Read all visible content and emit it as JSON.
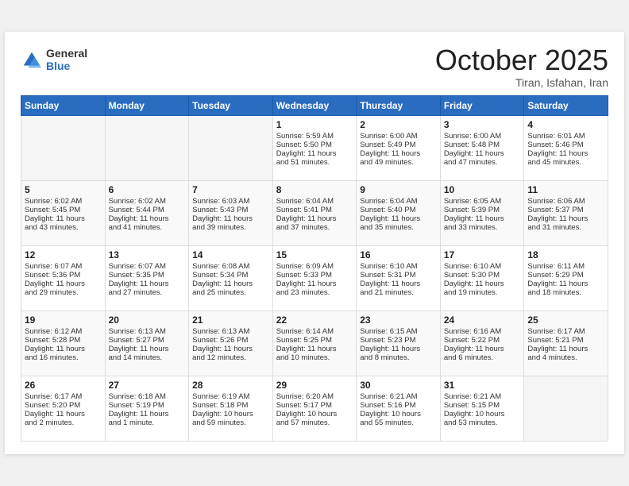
{
  "logo": {
    "general": "General",
    "blue": "Blue"
  },
  "header": {
    "month": "October 2025",
    "location": "Tiran, Isfahan, Iran"
  },
  "weekdays": [
    "Sunday",
    "Monday",
    "Tuesday",
    "Wednesday",
    "Thursday",
    "Friday",
    "Saturday"
  ],
  "weeks": [
    [
      {
        "day": "",
        "info": ""
      },
      {
        "day": "",
        "info": ""
      },
      {
        "day": "",
        "info": ""
      },
      {
        "day": "1",
        "info": "Sunrise: 5:59 AM\nSunset: 5:50 PM\nDaylight: 11 hours\nand 51 minutes."
      },
      {
        "day": "2",
        "info": "Sunrise: 6:00 AM\nSunset: 5:49 PM\nDaylight: 11 hours\nand 49 minutes."
      },
      {
        "day": "3",
        "info": "Sunrise: 6:00 AM\nSunset: 5:48 PM\nDaylight: 11 hours\nand 47 minutes."
      },
      {
        "day": "4",
        "info": "Sunrise: 6:01 AM\nSunset: 5:46 PM\nDaylight: 11 hours\nand 45 minutes."
      }
    ],
    [
      {
        "day": "5",
        "info": "Sunrise: 6:02 AM\nSunset: 5:45 PM\nDaylight: 11 hours\nand 43 minutes."
      },
      {
        "day": "6",
        "info": "Sunrise: 6:02 AM\nSunset: 5:44 PM\nDaylight: 11 hours\nand 41 minutes."
      },
      {
        "day": "7",
        "info": "Sunrise: 6:03 AM\nSunset: 5:43 PM\nDaylight: 11 hours\nand 39 minutes."
      },
      {
        "day": "8",
        "info": "Sunrise: 6:04 AM\nSunset: 5:41 PM\nDaylight: 11 hours\nand 37 minutes."
      },
      {
        "day": "9",
        "info": "Sunrise: 6:04 AM\nSunset: 5:40 PM\nDaylight: 11 hours\nand 35 minutes."
      },
      {
        "day": "10",
        "info": "Sunrise: 6:05 AM\nSunset: 5:39 PM\nDaylight: 11 hours\nand 33 minutes."
      },
      {
        "day": "11",
        "info": "Sunrise: 6:06 AM\nSunset: 5:37 PM\nDaylight: 11 hours\nand 31 minutes."
      }
    ],
    [
      {
        "day": "12",
        "info": "Sunrise: 6:07 AM\nSunset: 5:36 PM\nDaylight: 11 hours\nand 29 minutes."
      },
      {
        "day": "13",
        "info": "Sunrise: 6:07 AM\nSunset: 5:35 PM\nDaylight: 11 hours\nand 27 minutes."
      },
      {
        "day": "14",
        "info": "Sunrise: 6:08 AM\nSunset: 5:34 PM\nDaylight: 11 hours\nand 25 minutes."
      },
      {
        "day": "15",
        "info": "Sunrise: 6:09 AM\nSunset: 5:33 PM\nDaylight: 11 hours\nand 23 minutes."
      },
      {
        "day": "16",
        "info": "Sunrise: 6:10 AM\nSunset: 5:31 PM\nDaylight: 11 hours\nand 21 minutes."
      },
      {
        "day": "17",
        "info": "Sunrise: 6:10 AM\nSunset: 5:30 PM\nDaylight: 11 hours\nand 19 minutes."
      },
      {
        "day": "18",
        "info": "Sunrise: 6:11 AM\nSunset: 5:29 PM\nDaylight: 11 hours\nand 18 minutes."
      }
    ],
    [
      {
        "day": "19",
        "info": "Sunrise: 6:12 AM\nSunset: 5:28 PM\nDaylight: 11 hours\nand 16 minutes."
      },
      {
        "day": "20",
        "info": "Sunrise: 6:13 AM\nSunset: 5:27 PM\nDaylight: 11 hours\nand 14 minutes."
      },
      {
        "day": "21",
        "info": "Sunrise: 6:13 AM\nSunset: 5:26 PM\nDaylight: 11 hours\nand 12 minutes."
      },
      {
        "day": "22",
        "info": "Sunrise: 6:14 AM\nSunset: 5:25 PM\nDaylight: 11 hours\nand 10 minutes."
      },
      {
        "day": "23",
        "info": "Sunrise: 6:15 AM\nSunset: 5:23 PM\nDaylight: 11 hours\nand 8 minutes."
      },
      {
        "day": "24",
        "info": "Sunrise: 6:16 AM\nSunset: 5:22 PM\nDaylight: 11 hours\nand 6 minutes."
      },
      {
        "day": "25",
        "info": "Sunrise: 6:17 AM\nSunset: 5:21 PM\nDaylight: 11 hours\nand 4 minutes."
      }
    ],
    [
      {
        "day": "26",
        "info": "Sunrise: 6:17 AM\nSunset: 5:20 PM\nDaylight: 11 hours\nand 2 minutes."
      },
      {
        "day": "27",
        "info": "Sunrise: 6:18 AM\nSunset: 5:19 PM\nDaylight: 11 hours\nand 1 minute."
      },
      {
        "day": "28",
        "info": "Sunrise: 6:19 AM\nSunset: 5:18 PM\nDaylight: 10 hours\nand 59 minutes."
      },
      {
        "day": "29",
        "info": "Sunrise: 6:20 AM\nSunset: 5:17 PM\nDaylight: 10 hours\nand 57 minutes."
      },
      {
        "day": "30",
        "info": "Sunrise: 6:21 AM\nSunset: 5:16 PM\nDaylight: 10 hours\nand 55 minutes."
      },
      {
        "day": "31",
        "info": "Sunrise: 6:21 AM\nSunset: 5:15 PM\nDaylight: 10 hours\nand 53 minutes."
      },
      {
        "day": "",
        "info": ""
      }
    ]
  ]
}
